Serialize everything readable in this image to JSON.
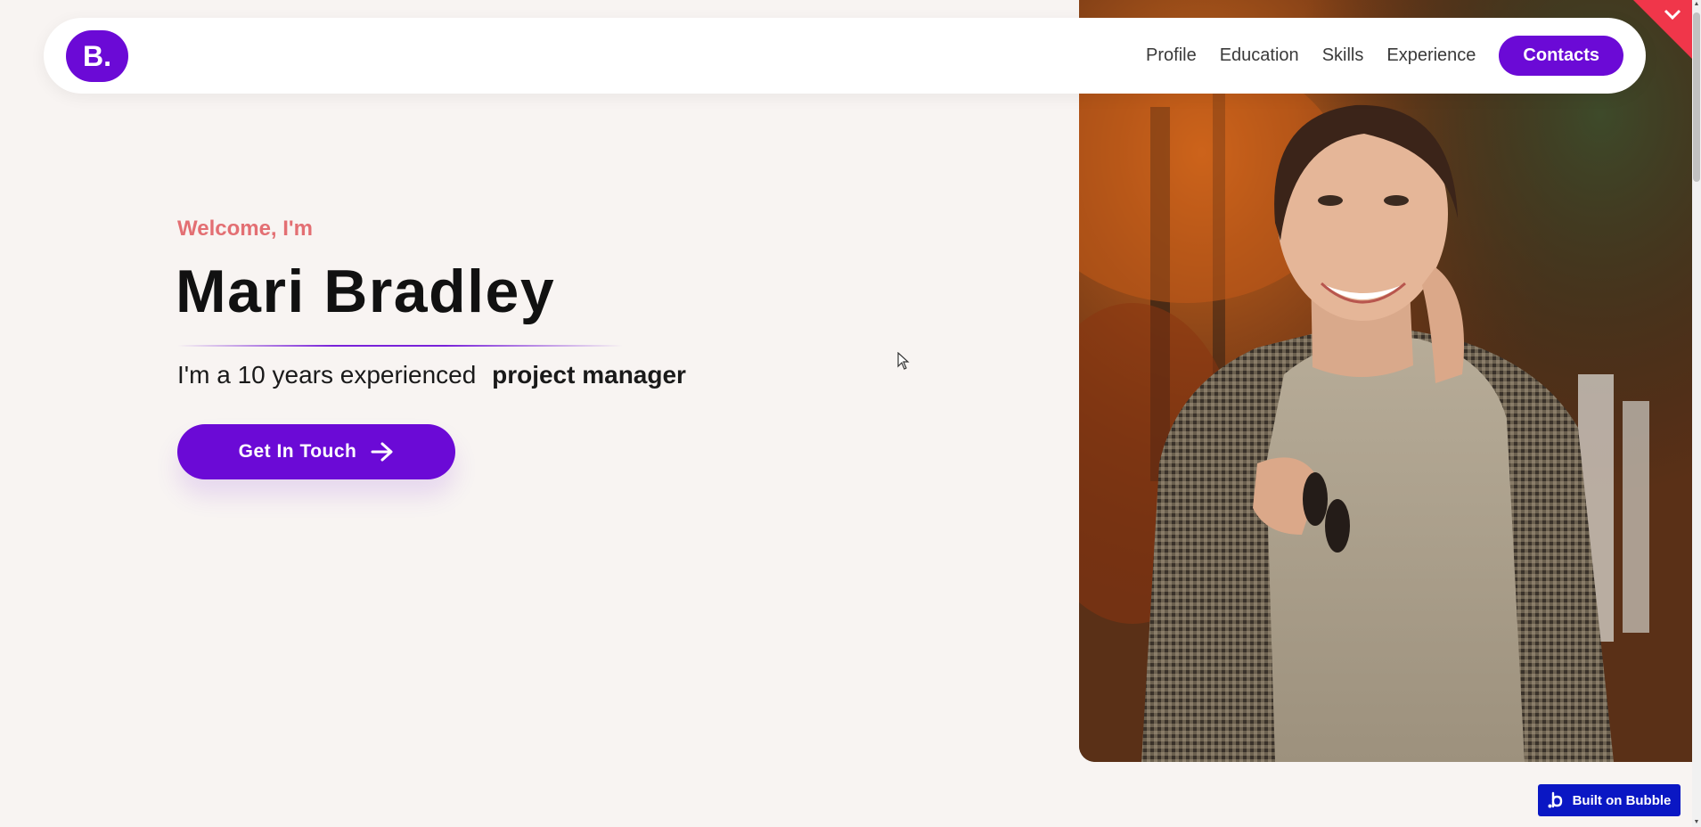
{
  "navbar": {
    "logo_text": "B.",
    "links": [
      "Profile",
      "Education",
      "Skills",
      "Experience"
    ],
    "contacts_label": "Contacts"
  },
  "hero": {
    "welcome": "Welcome, I'm",
    "name": "Mari Bradley",
    "tagline_prefix": "I'm a 10 years experienced",
    "tagline_role": "project manager",
    "cta_label": "Get In Touch"
  },
  "badge": {
    "label": "Built on Bubble"
  },
  "colors": {
    "accent": "#6b0ad6",
    "welcome": "#e36f73",
    "background": "#f8f4f2",
    "badge": "#0a17c4",
    "ribbon": "#f0364a"
  },
  "icons": {
    "cta": "arrow-right-icon",
    "ribbon": "chevron-down-icon",
    "badge": "bubble-logo-icon"
  }
}
